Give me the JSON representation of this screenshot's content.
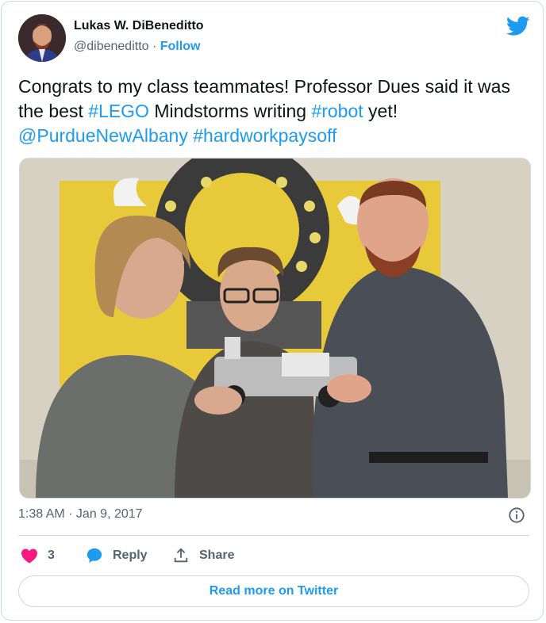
{
  "author": {
    "name": "Lukas W. DiBeneditto",
    "handle": "@dibeneditto",
    "separator": " · ",
    "follow_label": "Follow"
  },
  "tweet": {
    "parts": [
      {
        "text": "Congrats to my class teammates! Professor Dues said it was the best ",
        "link": false
      },
      {
        "text": "#LEGO",
        "link": true
      },
      {
        "text": " Mindstorms writing ",
        "link": false
      },
      {
        "text": "#robot",
        "link": true
      },
      {
        "text": " yet! ",
        "link": false
      },
      {
        "text": "@PurdueNewAlbany",
        "link": true
      },
      {
        "text": " ",
        "link": false
      },
      {
        "text": "#hardworkpaysoff",
        "link": true
      }
    ]
  },
  "timestamp": "1:38 AM · Jan 9, 2017",
  "actions": {
    "likes_count": "3",
    "reply_label": "Reply",
    "share_label": "Share"
  },
  "read_more_label": "Read more on Twitter",
  "colors": {
    "accent": "#1d9bf0",
    "heart": "#f91880",
    "secondary_text": "#536471",
    "border": "#cfd9de"
  },
  "icons": [
    "twitter-bird-icon",
    "info-icon",
    "heart-icon",
    "reply-bubble-icon",
    "share-icon"
  ]
}
